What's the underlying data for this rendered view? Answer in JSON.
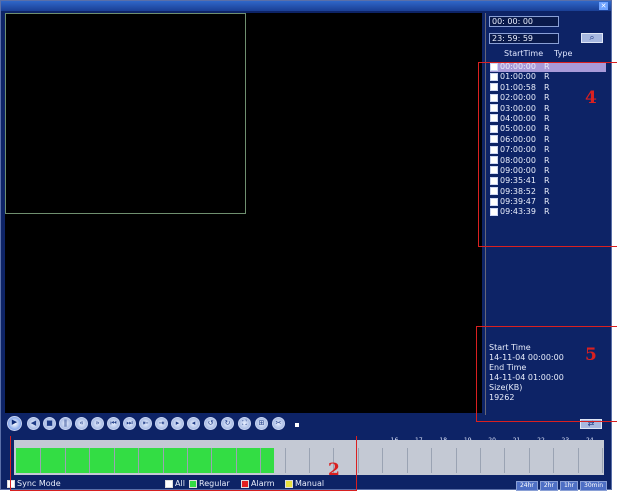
{
  "time_range": {
    "start": "00: 00: 00",
    "end": "23: 59: 59"
  },
  "list_header": {
    "col_start": "StartTime",
    "col_type": "Type"
  },
  "files": [
    {
      "time": "00:00:00",
      "type": "R"
    },
    {
      "time": "01:00:00",
      "type": "R"
    },
    {
      "time": "01:00:58",
      "type": "R"
    },
    {
      "time": "02:00:00",
      "type": "R"
    },
    {
      "time": "03:00:00",
      "type": "R"
    },
    {
      "time": "04:00:00",
      "type": "R"
    },
    {
      "time": "05:00:00",
      "type": "R"
    },
    {
      "time": "06:00:00",
      "type": "R"
    },
    {
      "time": "07:00:00",
      "type": "R"
    },
    {
      "time": "08:00:00",
      "type": "R"
    },
    {
      "time": "09:00:00",
      "type": "R"
    },
    {
      "time": "09:35:41",
      "type": "R"
    },
    {
      "time": "09:38:52",
      "type": "R"
    },
    {
      "time": "09:39:47",
      "type": "R"
    },
    {
      "time": "09:43:39",
      "type": "R"
    }
  ],
  "info": {
    "start_label": "Start Time",
    "start_value": "14-11-04 00:00:00",
    "end_label": "End Time",
    "end_value": "14-11-04 01:00:00",
    "size_label": "Size(KB)",
    "size_value": "19262"
  },
  "annotations": {
    "four": "4",
    "five": "5",
    "two": "2"
  },
  "timeline_hours": [
    "16",
    "17",
    "18",
    "19",
    "20",
    "21",
    "22",
    "23",
    "24"
  ],
  "recorded_fraction": 0.44,
  "bottom": {
    "sync_mode": "Sync Mode",
    "all": "All",
    "regular": "Regular",
    "alarm": "Alarm",
    "manual": "Manual"
  },
  "zoom_buttons": [
    "24hr",
    "2hr",
    "1hr",
    "30min"
  ],
  "colors": {
    "regular": "#33dd44",
    "alarm": "#e02020",
    "manual": "#e8e040"
  }
}
